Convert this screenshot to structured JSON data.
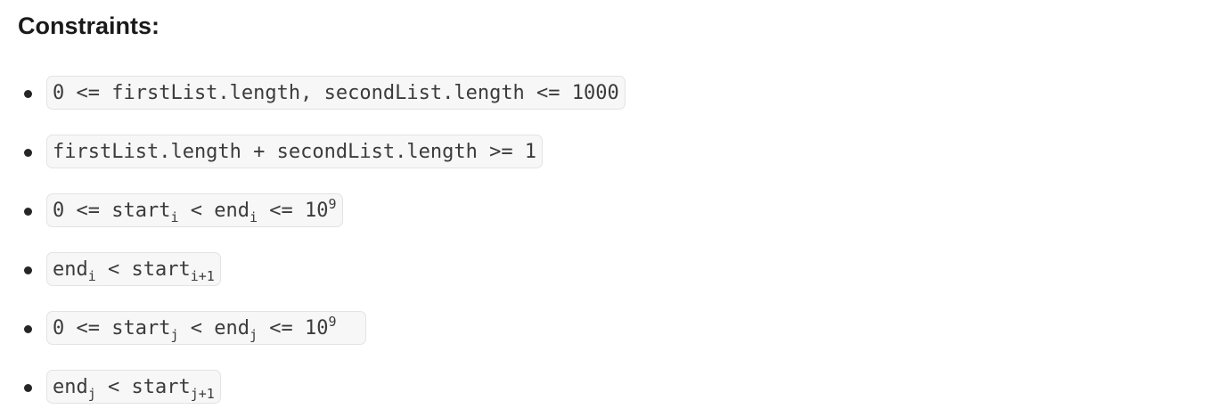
{
  "heading": "Constraints:",
  "items": [
    {
      "text": "0 <= firstList.length, secondList.length <= 1000"
    },
    {
      "text": "firstList.length + secondList.length >= 1"
    },
    {
      "a": "0 <= start",
      "a_sub": "i",
      "b": " < end",
      "b_sub": "i",
      "c": " <= 10",
      "c_sup": "9"
    },
    {
      "a": "end",
      "a_sub": "i",
      "b": " < start",
      "b_sub": "i+1"
    },
    {
      "a": "0 <= start",
      "a_sub": "j",
      "b": " < end",
      "b_sub": "j",
      "c": " <= 10",
      "c_sup": "9"
    },
    {
      "a": "end",
      "a_sub": "j",
      "b": " < start",
      "b_sub": "j+1"
    }
  ]
}
